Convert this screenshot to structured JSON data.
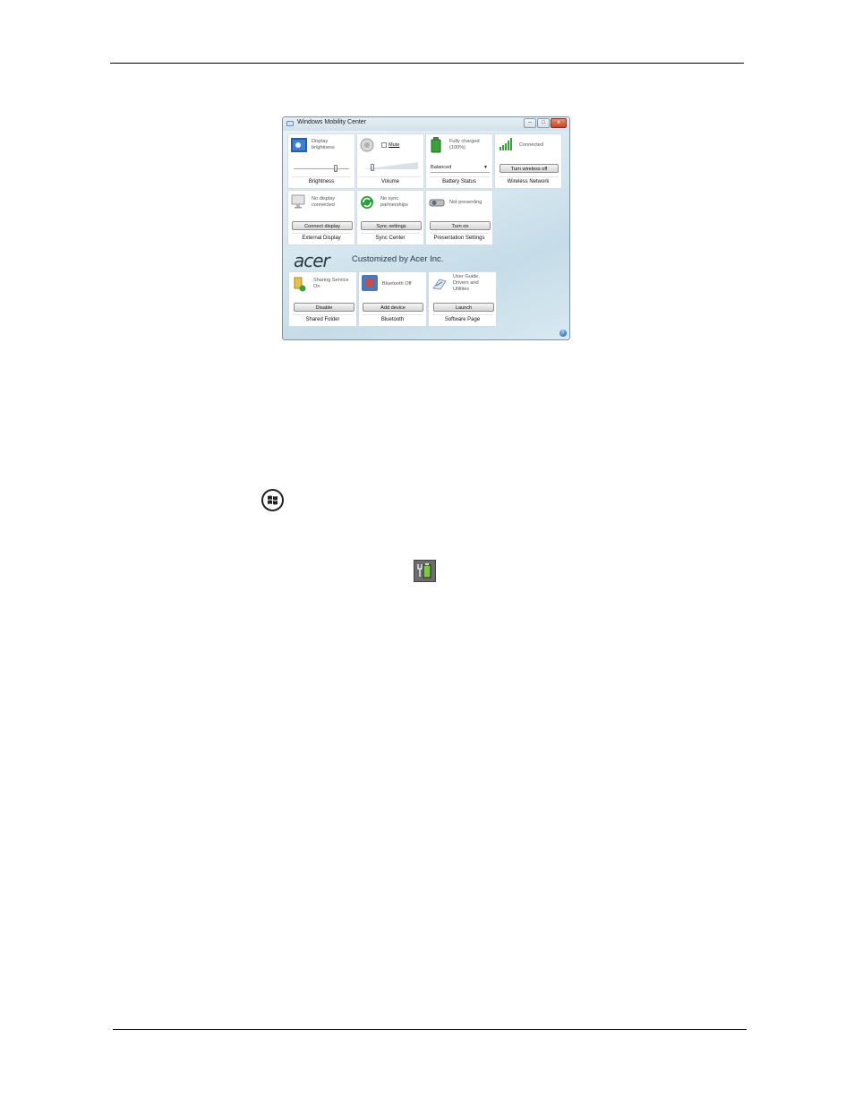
{
  "window": {
    "title": "Windows Mobility Center",
    "controls": {
      "minimize": "–",
      "maximize": "□",
      "close": "x"
    }
  },
  "tiles": {
    "brightness": {
      "status": "Display\nbrightness",
      "label": "Brightness",
      "level": 0.75,
      "icon": "display-brightness-icon"
    },
    "volume": {
      "checkbox_label": "Mute",
      "label": "Volume",
      "level": 0.18,
      "icon": "speaker-icon"
    },
    "battery": {
      "status": "Fully charged\n(100%)",
      "select_value": "Balanced",
      "label": "Battery Status",
      "icon": "battery-icon"
    },
    "wireless": {
      "status": "Connected",
      "button": "Turn wireless off",
      "label": "Wireless Network",
      "icon": "signal-bars-icon"
    },
    "external_display": {
      "status": "No display\nconnected",
      "button": "Connect display",
      "label": "External Display",
      "icon": "monitor-icon"
    },
    "sync": {
      "status": "No sync\npartnerships",
      "button": "Sync settings",
      "label": "Sync Center",
      "icon": "sync-icon"
    },
    "presentation": {
      "status": "Not presenting",
      "button": "Turn on",
      "label": "Presentation Settings",
      "icon": "projector-icon"
    }
  },
  "acer": {
    "logo": "acer",
    "subtitle": "Customized by Acer Inc."
  },
  "acer_tiles": {
    "shared_folder": {
      "status": "Sharing Service\nOn",
      "button": "Disable",
      "label": "Shared Folder",
      "icon": "shared-folder-icon"
    },
    "bluetooth": {
      "status": "Bluetooth Off",
      "button": "Add device",
      "label": "Bluetooth",
      "icon": "bluetooth-icon"
    },
    "software": {
      "status": "User Guide,\nDrivers and\nUtilities",
      "button": "Launch",
      "label": "Software Page",
      "icon": "software-page-icon"
    }
  },
  "colors": {
    "accent_blue": "#1f5fb0",
    "signal_green": "#3aa03a",
    "sync_green": "#2d9e3c"
  }
}
